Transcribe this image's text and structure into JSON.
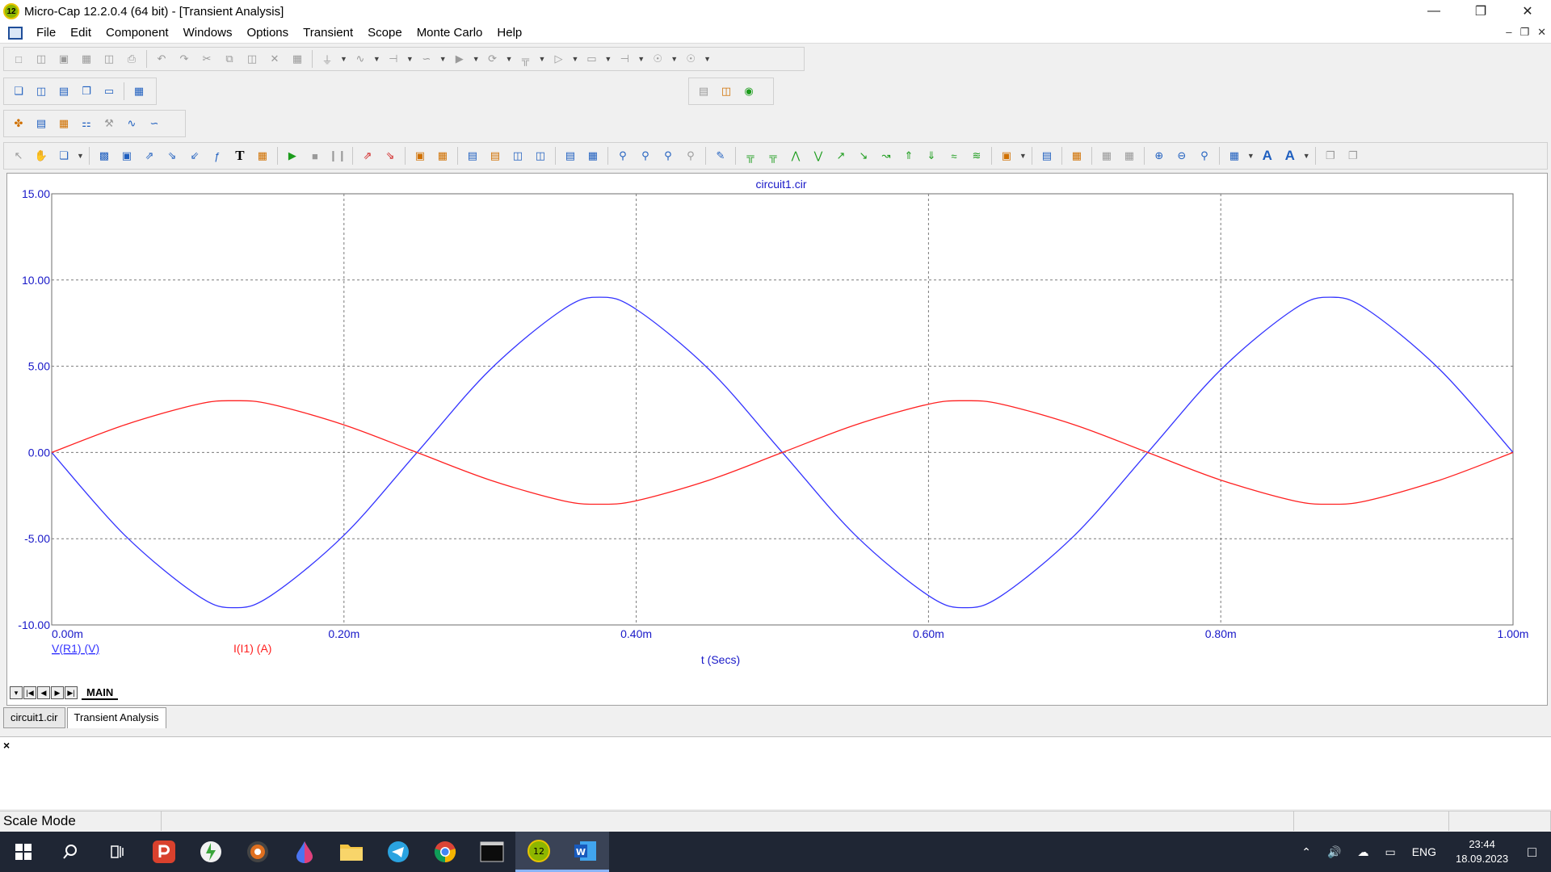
{
  "window": {
    "title": "Micro-Cap 12.2.0.4 (64 bit) - [Transient Analysis]",
    "app_icon_label": "12"
  },
  "menu": [
    "File",
    "Edit",
    "Component",
    "Windows",
    "Options",
    "Transient",
    "Scope",
    "Monte Carlo",
    "Help"
  ],
  "chart_data": {
    "type": "line",
    "title": "circuit1.cir",
    "xlabel": "t (Secs)",
    "x_ticks": [
      "0.00m",
      "0.20m",
      "0.40m",
      "0.60m",
      "0.80m",
      "1.00m"
    ],
    "y_ticks": [
      "15.00",
      "10.00",
      "5.00",
      "0.00",
      "-5.00",
      "-10.00"
    ],
    "xlim": [
      0,
      1.0
    ],
    "ylim": [
      -10,
      15
    ],
    "grid": true,
    "series": [
      {
        "name": "V(R1) (V)",
        "color": "#3434ff",
        "x": [
          0,
          0.05,
          0.1,
          0.125,
          0.15,
          0.2,
          0.25,
          0.3,
          0.35,
          0.375,
          0.4,
          0.45,
          0.5,
          0.55,
          0.6,
          0.625,
          0.65,
          0.7,
          0.75,
          0.8,
          0.85,
          0.875,
          0.9,
          0.95,
          1.0
        ],
        "y": [
          0,
          -4.8,
          -8.3,
          -9.0,
          -8.3,
          -4.8,
          0,
          4.8,
          8.3,
          9.0,
          8.3,
          4.8,
          0,
          -4.8,
          -8.3,
          -9.0,
          -8.3,
          -4.8,
          0,
          4.8,
          8.3,
          9.0,
          8.3,
          4.8,
          0
        ]
      },
      {
        "name": "I(I1) (A)",
        "color": "#ff2020",
        "x": [
          0,
          0.05,
          0.1,
          0.125,
          0.15,
          0.2,
          0.25,
          0.3,
          0.35,
          0.375,
          0.4,
          0.45,
          0.5,
          0.55,
          0.6,
          0.625,
          0.65,
          0.7,
          0.75,
          0.8,
          0.85,
          0.875,
          0.9,
          0.95,
          1.0
        ],
        "y": [
          0,
          1.6,
          2.8,
          3.0,
          2.8,
          1.6,
          0,
          -1.6,
          -2.8,
          -3.0,
          -2.8,
          -1.6,
          0,
          1.6,
          2.8,
          3.0,
          2.8,
          1.6,
          0,
          -1.6,
          -2.8,
          -3.0,
          -2.8,
          -1.6,
          0
        ]
      }
    ]
  },
  "page_tabs": {
    "nav_buttons": [
      "▾",
      "|◀",
      "◀",
      "▶",
      "▶|"
    ],
    "active": "MAIN"
  },
  "doc_tabs": [
    "circuit1.cir",
    "Transient Analysis"
  ],
  "output_close": "×",
  "status": {
    "mode": "Scale Mode"
  },
  "taskbar": {
    "lang": "ENG",
    "time": "23:44",
    "date": "18.09.2023"
  }
}
